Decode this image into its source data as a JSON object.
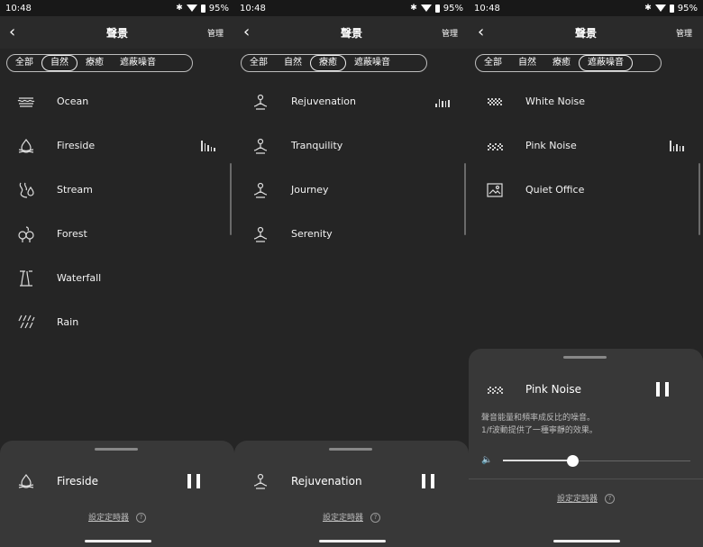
{
  "status": {
    "time": "10:48",
    "battery": "95%"
  },
  "app": {
    "title": "聲景",
    "manage": "管理"
  },
  "tabs": [
    "全部",
    "自然",
    "療癒",
    "遮蔽噪音"
  ],
  "screens": [
    {
      "active_tab": 1,
      "items": [
        {
          "label": "Ocean",
          "icon": "ocean-icon"
        },
        {
          "label": "Fireside",
          "icon": "fireside-icon",
          "playing": true
        },
        {
          "label": "Stream",
          "icon": "stream-icon"
        },
        {
          "label": "Forest",
          "icon": "forest-icon"
        },
        {
          "label": "Waterfall",
          "icon": "waterfall-icon"
        },
        {
          "label": "Rain",
          "icon": "rain-icon"
        }
      ],
      "player": {
        "label": "Fireside",
        "icon": "fireside-icon"
      },
      "timer": "設定定時器"
    },
    {
      "active_tab": 2,
      "items": [
        {
          "label": "Rejuvenation",
          "icon": "meditation-icon",
          "playing": true
        },
        {
          "label": "Tranquility",
          "icon": "meditation-icon"
        },
        {
          "label": "Journey",
          "icon": "meditation-icon"
        },
        {
          "label": "Serenity",
          "icon": "meditation-icon"
        }
      ],
      "player": {
        "label": "Rejuvenation",
        "icon": "meditation-icon"
      },
      "timer": "設定定時器"
    },
    {
      "active_tab": 3,
      "items": [
        {
          "label": "White Noise",
          "icon": "white-noise-icon"
        },
        {
          "label": "Pink Noise",
          "icon": "pink-noise-icon",
          "playing": true
        },
        {
          "label": "Quiet Office",
          "icon": "office-icon"
        }
      ],
      "player": {
        "label": "Pink Noise",
        "icon": "pink-noise-icon",
        "description_line1": "聲音能量和頻率成反比的噪音。",
        "description_line2": "1/f波動提供了一種寧靜的效果。",
        "volume": 0.37
      },
      "timer": "設定定時器"
    }
  ]
}
